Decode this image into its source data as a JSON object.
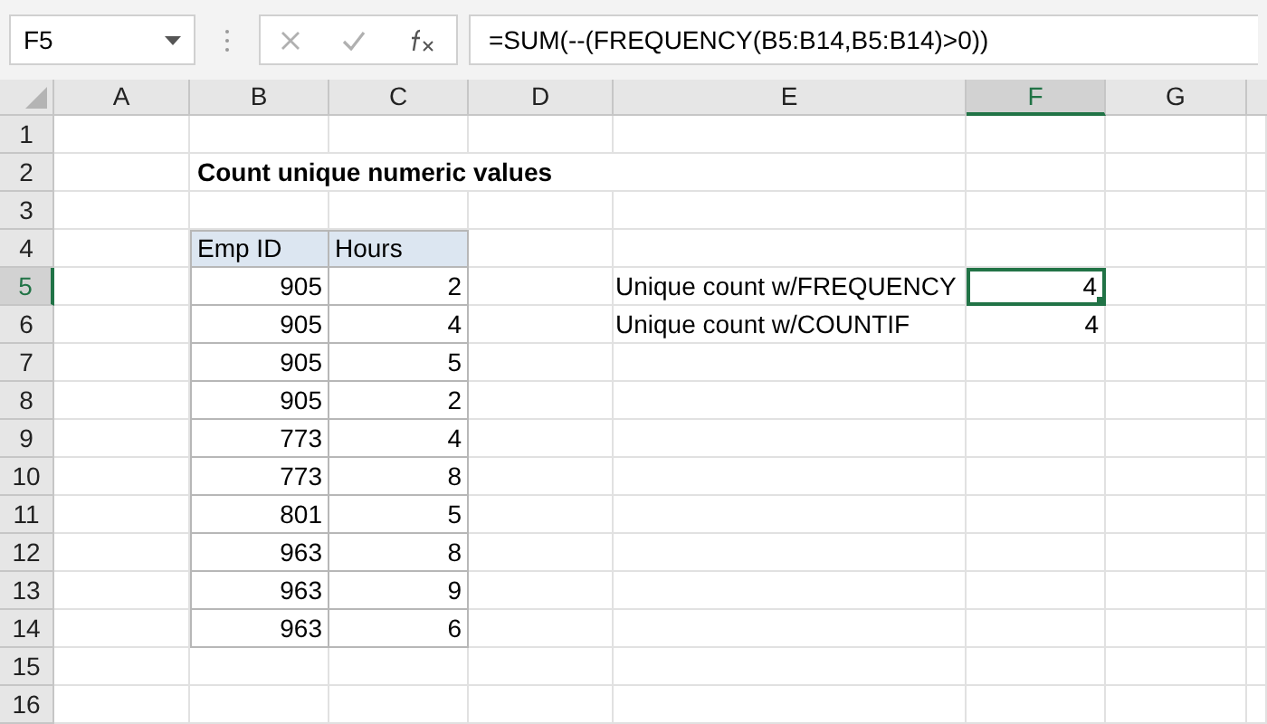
{
  "name_box": {
    "value": "F5"
  },
  "formula_bar": {
    "value": "=SUM(--(FREQUENCY(B5:B14,B5:B14)>0))"
  },
  "column_headers": [
    {
      "label": "A",
      "selected": false
    },
    {
      "label": "B",
      "selected": false
    },
    {
      "label": "C",
      "selected": false
    },
    {
      "label": "D",
      "selected": false
    },
    {
      "label": "E",
      "selected": false
    },
    {
      "label": "F",
      "selected": true
    },
    {
      "label": "G",
      "selected": false
    }
  ],
  "row_headers": [
    {
      "label": "1",
      "selected": false
    },
    {
      "label": "2",
      "selected": false
    },
    {
      "label": "3",
      "selected": false
    },
    {
      "label": "4",
      "selected": false
    },
    {
      "label": "5",
      "selected": true
    },
    {
      "label": "6",
      "selected": false
    },
    {
      "label": "7",
      "selected": false
    },
    {
      "label": "8",
      "selected": false
    },
    {
      "label": "9",
      "selected": false
    },
    {
      "label": "10",
      "selected": false
    },
    {
      "label": "11",
      "selected": false
    },
    {
      "label": "12",
      "selected": false
    },
    {
      "label": "13",
      "selected": false
    },
    {
      "label": "14",
      "selected": false
    },
    {
      "label": "15",
      "selected": false
    },
    {
      "label": "16",
      "selected": false
    }
  ],
  "title": "Count unique numeric values",
  "table": {
    "columns": [
      "Emp ID",
      "Hours"
    ],
    "rows": [
      [
        "905",
        "2"
      ],
      [
        "905",
        "4"
      ],
      [
        "905",
        "5"
      ],
      [
        "905",
        "2"
      ],
      [
        "773",
        "4"
      ],
      [
        "773",
        "8"
      ],
      [
        "801",
        "5"
      ],
      [
        "963",
        "8"
      ],
      [
        "963",
        "9"
      ],
      [
        "963",
        "6"
      ]
    ]
  },
  "results": [
    {
      "label": "Unique count w/FREQUENCY",
      "value": "4",
      "selected": true
    },
    {
      "label": "Unique count w/COUNTIF",
      "value": "4",
      "selected": false
    }
  ]
}
